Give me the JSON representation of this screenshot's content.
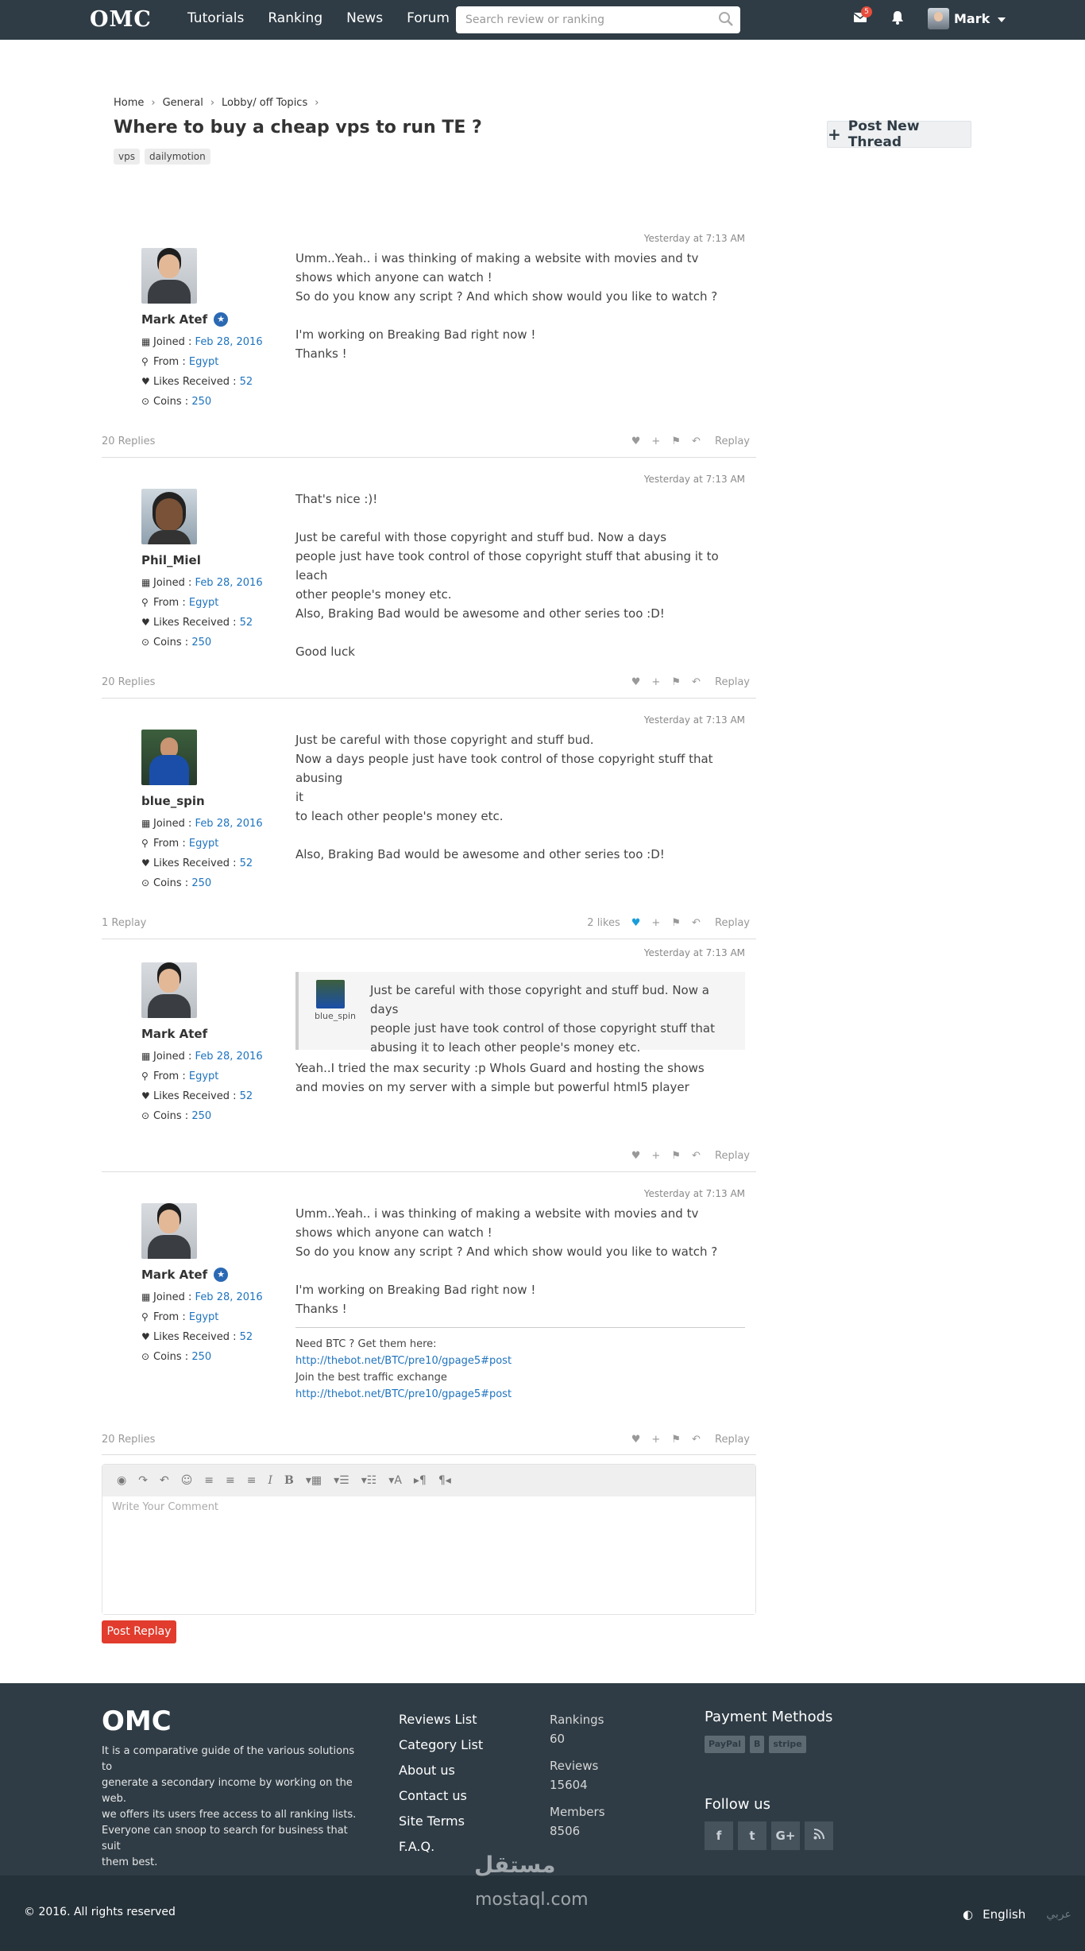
{
  "header": {
    "logo": "OMC",
    "nav": [
      "Tutorials",
      "Ranking",
      "News",
      "Forum"
    ],
    "search_placeholder": "Search review or ranking",
    "notification_count": "5",
    "user_name": "Mark"
  },
  "breadcrumb": [
    "Home",
    "General",
    "Lobby/ off Topics"
  ],
  "thread": {
    "title": "Where to buy a cheap vps to run TE ?",
    "tags": [
      "vps",
      "dailymotion"
    ],
    "new_thread_label": "Post New Thread"
  },
  "labels": {
    "joined": "Joined :",
    "from": "From :",
    "likes_received": "Likes Received :",
    "coins": "Coins :",
    "reply_action": "Replay"
  },
  "posts": [
    {
      "timestamp": "Yesterday at 7:13 AM",
      "user": "Mark Atef",
      "joined": "Feb 28, 2016",
      "from": "Egypt",
      "likes": "52",
      "coins": "250",
      "lines": [
        "Umm..Yeah.. i was thinking of making a website with movies and tv",
        "shows which anyone can watch !",
        "So do you know any script ? And which show would you like to watch ?",
        "",
        "I'm working on Breaking Bad right now !",
        "Thanks !"
      ],
      "footer_left": "20 Replies",
      "footer_likes": ""
    },
    {
      "timestamp": "Yesterday at 7:13 AM",
      "user": "Phil_Miel",
      "joined": "Feb 28, 2016",
      "from": "Egypt",
      "likes": "52",
      "coins": "250",
      "lines": [
        "That's nice :)!",
        "",
        "Just be careful with those copyright and stuff bud. Now a days",
        "people just have took control of those copyright stuff that abusing it to leach",
        "other people's money etc.",
        "Also, Braking Bad would be awesome and other series too :D!",
        "",
        "Good luck"
      ],
      "footer_left": "20 Replies",
      "footer_likes": ""
    },
    {
      "timestamp": "Yesterday at 7:13 AM",
      "user": "blue_spin",
      "joined": "Feb 28, 2016",
      "from": "Egypt",
      "likes": "52",
      "coins": "250",
      "lines": [
        "Just be careful with those copyright and stuff bud.",
        "Now a days people just have took control of those copyright stuff that abusing",
        "it",
        "to leach other people's money etc.",
        "",
        "Also, Braking Bad would be awesome and other series too :D!"
      ],
      "footer_left": "1 Replay",
      "footer_likes": "2 likes"
    },
    {
      "timestamp": "Yesterday at 7:13 AM",
      "user": "Mark Atef",
      "joined": "Feb 28, 2016",
      "from": "Egypt",
      "likes": "52",
      "coins": "250",
      "quote_user": "blue_spin",
      "quote_lines": [
        "Just be careful with those copyright and stuff bud. Now a days",
        "people just have took control of those copyright stuff that",
        "abusing it to leach other people's money etc."
      ],
      "lines": [
        "Yeah..I tried the max security :p WhoIs Guard and hosting the shows",
        "and movies on my server with a simple but powerful html5 player"
      ],
      "footer_left": "",
      "footer_likes": ""
    },
    {
      "timestamp": "Yesterday at 7:13 AM",
      "user": "Mark Atef",
      "joined": "Feb 28, 2016",
      "from": "Egypt",
      "likes": "52",
      "coins": "250",
      "lines": [
        "Umm..Yeah.. i was thinking of making a website with movies and tv",
        "shows which anyone can watch !",
        "So do you know any script ? And which show would you like to watch ?",
        "",
        "I'm working on Breaking Bad right now !",
        "Thanks !"
      ],
      "signature": [
        "Need BTC ? Get them here:",
        "http://thebot.net/BTC/pre10/gpage5#post",
        "Join the best traffic exchange",
        "http://thebot.net/BTC/pre10/gpage5#post"
      ],
      "footer_left": "20 Replies",
      "footer_likes": ""
    }
  ],
  "editor": {
    "placeholder": "Write Your Comment",
    "submit_label": "Post Replay"
  },
  "footer": {
    "logo": "OMC",
    "description": [
      "It is a comparative guide of the various solutions to",
      "generate a secondary income by working on the",
      "web.",
      "we offers its users free access to all ranking lists.",
      "Everyone can snoop to search for business that suit",
      "them best."
    ],
    "links": [
      "Reviews List",
      "Category List",
      "About us",
      "Contact us",
      "Site Terms",
      "F.A.Q."
    ],
    "stats": [
      {
        "label": "Rankings",
        "value": "60"
      },
      {
        "label": "Reviews",
        "value": "15604"
      },
      {
        "label": "Members",
        "value": "8506"
      }
    ],
    "payment_title": "Payment Methods",
    "payment_methods": [
      "PayPal",
      "B",
      "stripe"
    ],
    "follow_title": "Follow us",
    "social": [
      "f",
      "t",
      "G+",
      "rss"
    ],
    "copyright": "© 2016. All rights reserved",
    "language": "English",
    "language_alt": "عربي",
    "watermark": "مستقل",
    "watermark_url": "mostaql.com"
  }
}
